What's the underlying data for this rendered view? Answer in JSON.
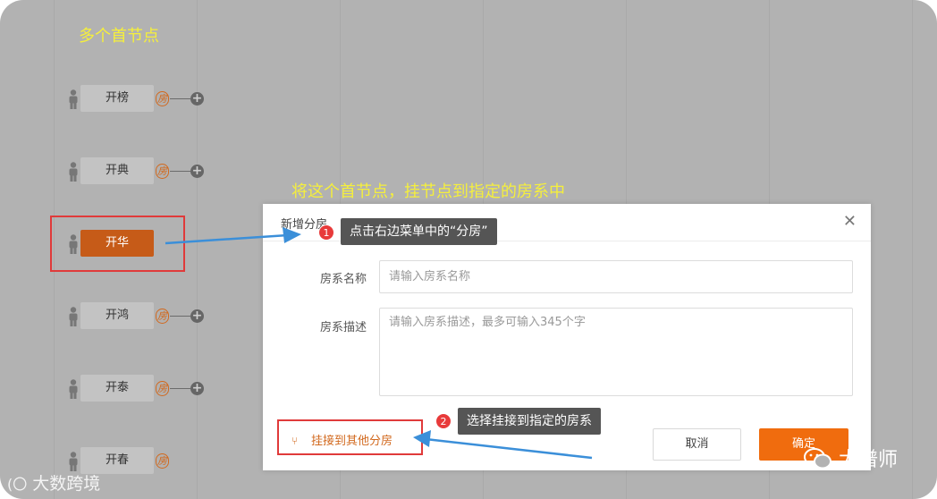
{
  "annotations": {
    "top_title": "多个首节点",
    "middle_title": "将这个首节点，挂节点到指定的房系中",
    "step1": {
      "number": "1",
      "text": "点击右边菜单中的“分房”"
    },
    "step2": {
      "number": "2",
      "text": "选择挂接到指定的房系"
    }
  },
  "tree": {
    "badge": "房",
    "nodes": [
      {
        "label": "开榜"
      },
      {
        "label": "开典"
      },
      {
        "label": "开华"
      },
      {
        "label": "开鸿"
      },
      {
        "label": "开泰"
      },
      {
        "label": "开春"
      }
    ]
  },
  "dialog": {
    "title": "新增分房",
    "name_label": "房系名称",
    "name_placeholder": "请输入房系名称",
    "desc_label": "房系描述",
    "desc_placeholder": "请输入房系描述，最多可输入345个字",
    "attach_link": "挂接到其他分房",
    "cancel": "取消",
    "confirm": "确定"
  },
  "watermarks": {
    "left": "大数跨境",
    "right": "大谱师"
  },
  "colors": {
    "background": "#b2b2b2",
    "accent_orange": "#f06c0e",
    "active_node": "#c65b18",
    "annotation_yellow": "#f5ef3c",
    "highlight_red": "#e03a3a",
    "arrow_blue": "#3b8fd9"
  }
}
